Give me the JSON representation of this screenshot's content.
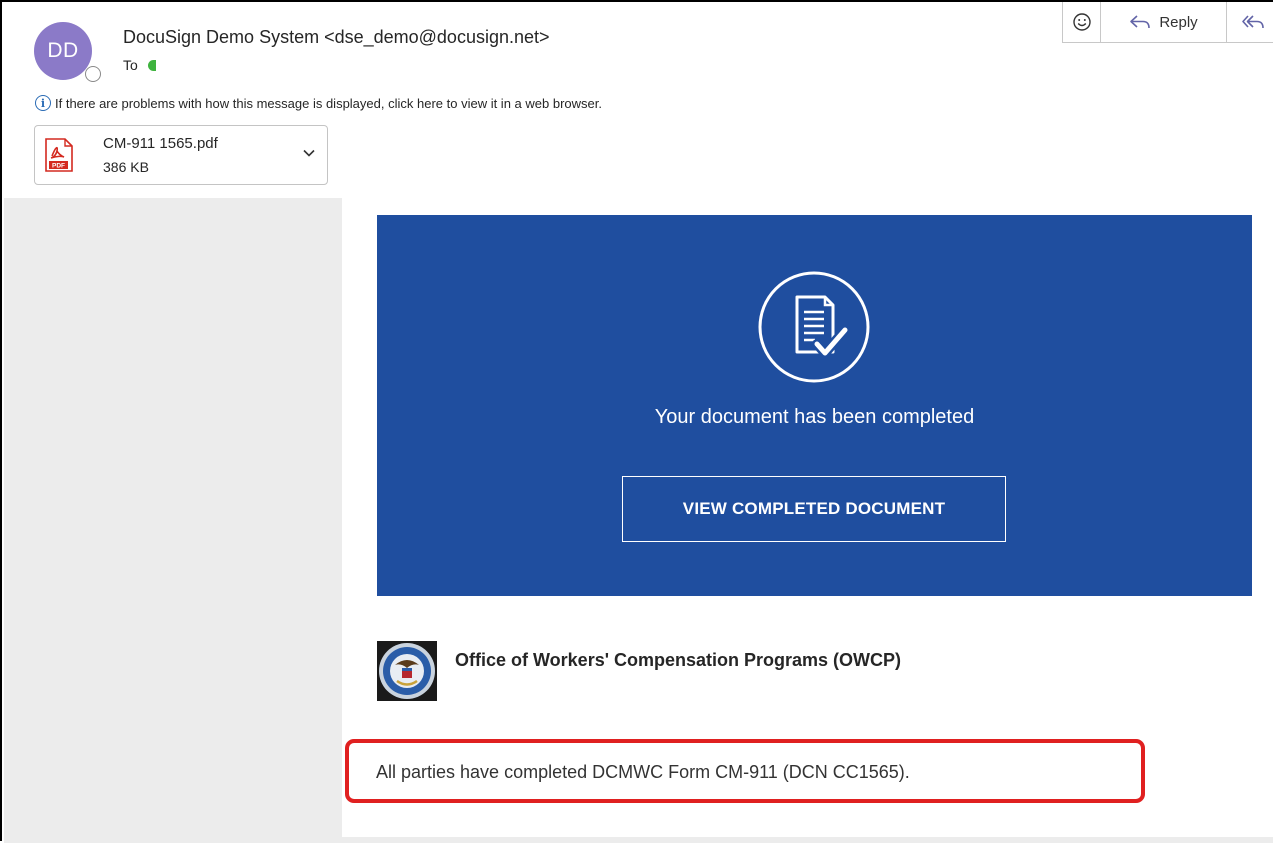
{
  "colors": {
    "avatar": "#8b7ac8",
    "hero": "#1f4e9f",
    "canvas": "#ececec",
    "highlight": "#e02020",
    "info": "#2b6cb5",
    "pdf_red": "#d42a20"
  },
  "header": {
    "avatar_initials": "DD",
    "sender": "DocuSign Demo System <dse_demo@docusign.net>",
    "to_label": "To"
  },
  "toolbar": {
    "emoji_icon": "smiley-icon",
    "reply_label": "Reply",
    "reply_icon": "reply-arrow-icon",
    "reply_all_icon": "reply-all-arrow-icon"
  },
  "info_bar": {
    "icon": "info-icon",
    "text": "If there are problems with how this message is displayed, click here to view it in a web browser."
  },
  "attachment": {
    "icon": "pdf-file-icon",
    "icon_label": "PDF",
    "name": "CM-911 1565.pdf",
    "size": "386 KB",
    "chevron": "chevron-down-icon"
  },
  "email_body": {
    "hero_icon": "document-check-icon",
    "hero_text": "Your document has been completed",
    "button_label": "VIEW COMPLETED DOCUMENT",
    "seal_icon": "dol-seal-icon",
    "org_name": "Office of Workers' Compensation Programs (OWCP)",
    "message": "All parties have completed DCMWC Form CM-911 (DCN CC1565)."
  }
}
